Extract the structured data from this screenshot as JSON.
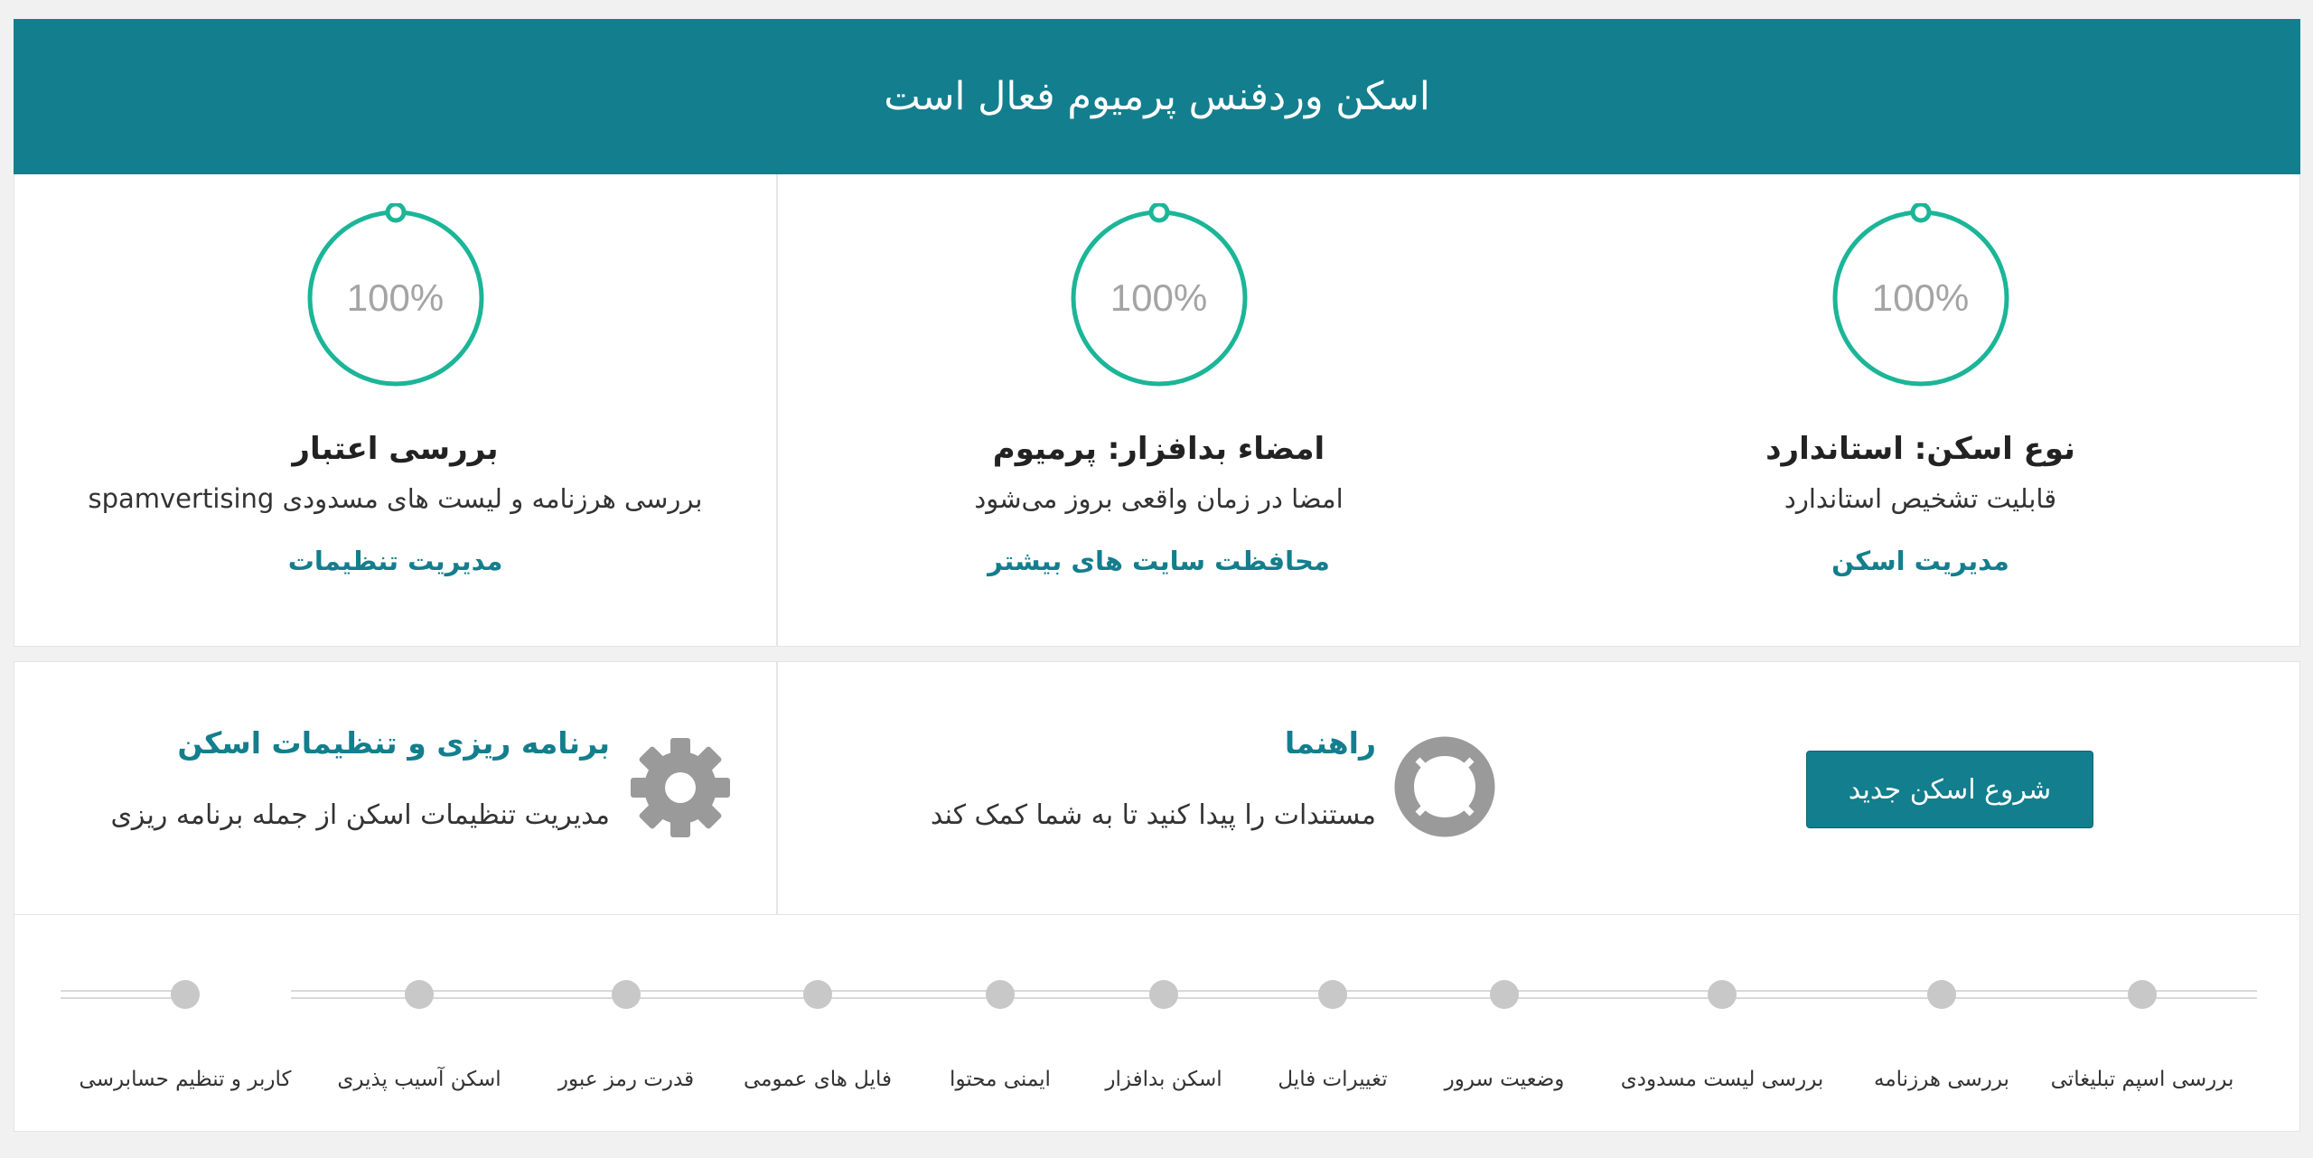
{
  "banner": {
    "title": "اسکن وردفنس پرمیوم فعال است"
  },
  "stats": [
    {
      "percent": "100%",
      "title": "نوع اسکن: استاندارد",
      "description": "قابلیت تشخیص استاندارد",
      "link": "مدیریت اسکن"
    },
    {
      "percent": "100%",
      "title": "امضاء بدافزار: پرمیوم",
      "description": "امضا در زمان واقعی بروز می‌شود",
      "link": "محافظت سایت های بیشتر"
    },
    {
      "percent": "100%",
      "title": "بررسی اعتبار",
      "description": "بررسی هرزنامه و لیست های مسدودی spamvertising",
      "link": "مدیریت تنظیمات"
    }
  ],
  "actions": {
    "start_scan": "شروع اسکن جدید",
    "help": {
      "title": "راهنما",
      "description": "مستندات را پیدا کنید تا به شما کمک کند"
    },
    "schedule": {
      "title": "برنامه ریزی و تنظیمات اسکن",
      "description": "مدیریت تنظیمات اسکن از جمله برنامه ریزی"
    }
  },
  "timeline": {
    "stages": [
      "بررسی اسپم تبلیغاتی",
      "بررسی هرزنامه",
      "بررسی لیست مسدودی",
      "وضعیت سرور",
      "تغییرات فایل",
      "اسکن بدافزار",
      "ایمنی محتوا",
      "فایل های عمومی",
      "قدرت رمز عبور",
      "اسکن آسیب پذیری",
      "کاربر و تنظیم حسابرسی"
    ]
  },
  "colors": {
    "accent": "#137e8d",
    "gauge": "#1bb597",
    "dot": "#c8c8c8"
  },
  "icons": {
    "help": "lifebuoy-icon",
    "schedule": "gear-icon"
  }
}
